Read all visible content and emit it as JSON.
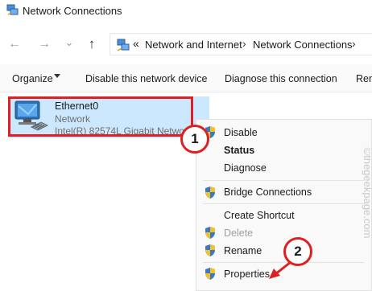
{
  "window": {
    "title": "Network Connections"
  },
  "address_bar": {
    "overflow": "«",
    "crumbs": [
      "Network and Internet",
      "Network Connections"
    ],
    "separator": "›"
  },
  "nav": {
    "back": "←",
    "forward": "→",
    "history": "⌄",
    "up": "↑"
  },
  "toolbar": {
    "organize": "Organize",
    "disable": "Disable this network device",
    "diagnose": "Diagnose this connection",
    "rename_partial": "Ren"
  },
  "adapter": {
    "name": "Ethernet0",
    "status": "Network",
    "device": "Intel(R) 82574L Gigabit Network"
  },
  "context_menu": {
    "disable": "Disable",
    "status": "Status",
    "diagnose": "Diagnose",
    "bridge": "Bridge Connections",
    "create_shortcut": "Create Shortcut",
    "delete": "Delete",
    "rename": "Rename",
    "properties": "Properties"
  },
  "annotations": {
    "step1": "1",
    "step2": "2",
    "color": "#e02020"
  },
  "watermark": "©thegeekpage.com",
  "colors": {
    "selection": "#cce8ff",
    "menu_bg": "#f9f9f9",
    "highlight_border": "#e02020"
  }
}
